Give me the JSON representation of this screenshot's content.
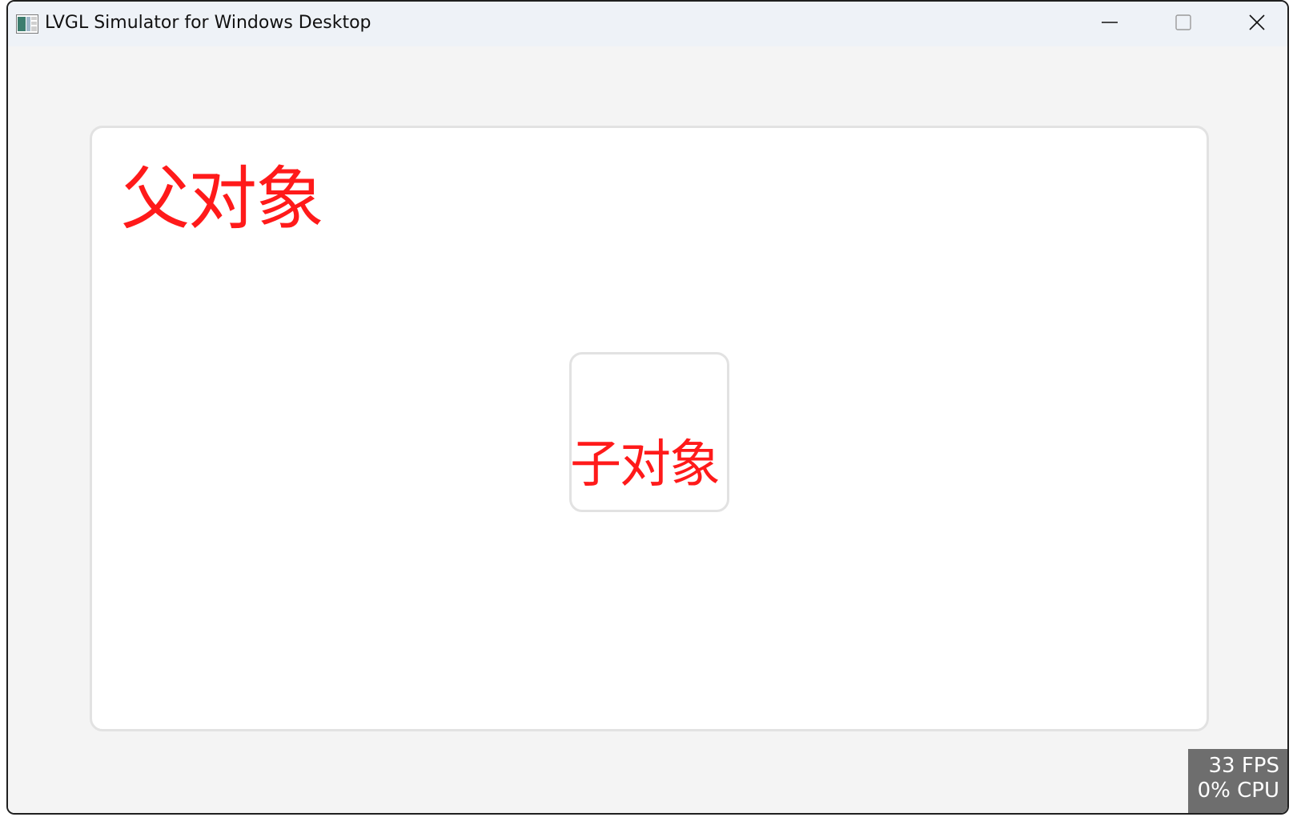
{
  "window": {
    "title": "LVGL Simulator for Windows Desktop",
    "controls": {
      "minimize_icon": "minimize-icon",
      "maximize_icon": "maximize-icon",
      "close_icon": "close-icon"
    }
  },
  "screen": {
    "parent_object": {
      "label": "父对象"
    },
    "child_object": {
      "label": "子对象"
    }
  },
  "perf_monitor": {
    "fps": "33 FPS",
    "cpu": "0% CPU"
  },
  "colors": {
    "label_text": "#ff1a1a",
    "object_border": "#e2e2e2",
    "object_bg": "#ffffff",
    "screen_bg": "#f4f4f4",
    "perf_bg": "#6e6e6e"
  }
}
